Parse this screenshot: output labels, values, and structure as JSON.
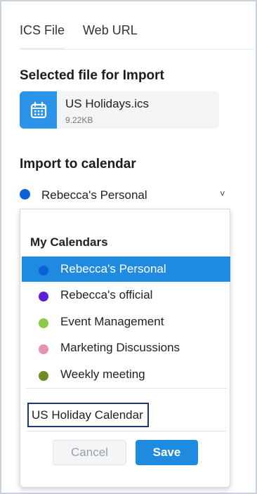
{
  "tabs": [
    {
      "label": "ICS File",
      "active": true
    },
    {
      "label": "Web URL",
      "active": false
    }
  ],
  "selected_file": {
    "heading": "Selected file for Import",
    "icon": "calendar-icon",
    "name": "US Holidays.ics",
    "size": "9.22KB"
  },
  "import_to": {
    "heading": "Import to calendar",
    "selected": {
      "label": "Rebecca's Personal",
      "color": "#0b62d6"
    },
    "chevron": "˅"
  },
  "dropdown": {
    "heading": "My Calendars",
    "items": [
      {
        "label": "Rebecca's Personal",
        "color": "#0b62d6",
        "selected": true
      },
      {
        "label": "Rebecca's official",
        "color": "#5a1fd6",
        "selected": false
      },
      {
        "label": "Event Management",
        "color": "#8bc94a",
        "selected": false
      },
      {
        "label": "Marketing Discussions",
        "color": "#e591b8",
        "selected": false
      },
      {
        "label": "Weekly meeting",
        "color": "#6e8c25",
        "selected": false
      }
    ],
    "new_calendar_value": "US Holiday Calendar",
    "cancel_label": "Cancel",
    "save_label": "Save"
  },
  "colors": {
    "accent": "#1f8be0",
    "focus_border": "#1b3a6b"
  }
}
